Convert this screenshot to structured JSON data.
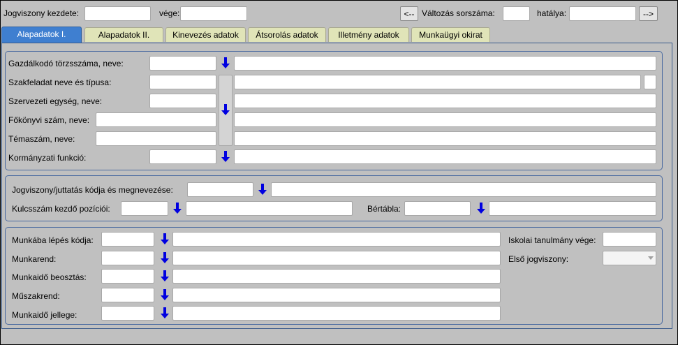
{
  "header": {
    "start_label": "Jogviszony kezdete:",
    "start_value": "",
    "end_label": "vége:",
    "end_value": "",
    "prev_button": "<--",
    "change_label": "Változás sorszáma:",
    "change_value": "",
    "effect_label": "hatálya:",
    "effect_value": "",
    "next_button": "-->"
  },
  "tabs": [
    {
      "label": "Alapadatok I."
    },
    {
      "label": "Alapadatok II."
    },
    {
      "label": "Kinevezés adatok"
    },
    {
      "label": "Átsorolás adatok"
    },
    {
      "label": "Illetmény adatok"
    },
    {
      "label": "Munkaügyi okirat"
    }
  ],
  "group1": {
    "rows": [
      {
        "label": "Gazdálkodó törzsszáma, neve:"
      },
      {
        "label": "Szakfeladat neve és típusa:"
      },
      {
        "label": "Szervezeti egység, neve:"
      },
      {
        "label": "Főkönyvi szám, neve:"
      },
      {
        "label": "Témaszám, neve:"
      },
      {
        "label": "Kormányzati funkció:"
      }
    ]
  },
  "group2": {
    "legal_label": "Jogviszony/juttatás kódja és megnevezése:",
    "key_label": "Kulcsszám kezdő pozíciói:",
    "wage_label": "Bértábla:"
  },
  "group3": {
    "rows": [
      {
        "label": "Munkába lépés kódja:"
      },
      {
        "label": "Munkarend:"
      },
      {
        "label": "Munkaidő beosztás:"
      },
      {
        "label": "Műszakrend:"
      },
      {
        "label": "Munkaidő jellege:"
      }
    ],
    "school_label": "Iskolai tanulmány vége:",
    "first_legal_label": "Első jogviszony:"
  },
  "colors": {
    "background": "#c0c0c0",
    "active_tab": "#3f7fd0",
    "inactive_tab": "#e0e4b8",
    "arrow": "#0000e0",
    "group_border": "#4a6aa0"
  }
}
